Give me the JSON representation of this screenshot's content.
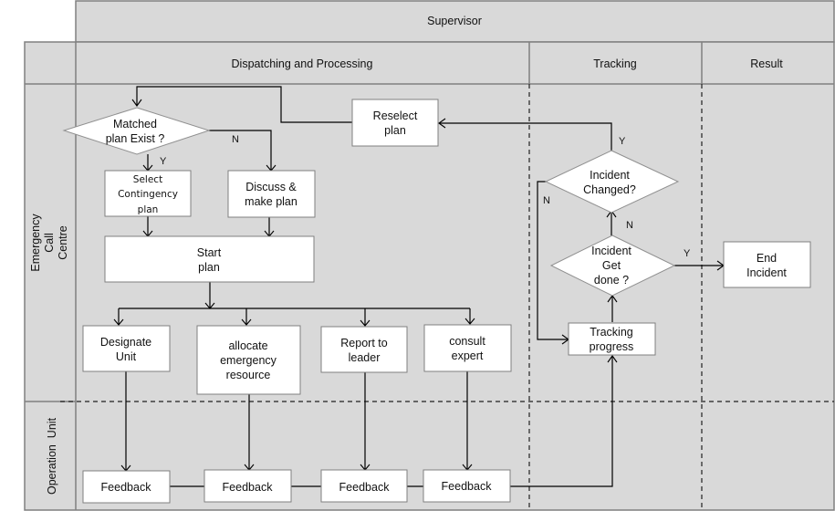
{
  "lanes": {
    "supervisor": "Supervisor",
    "columns": [
      "Dispatching and Processing",
      "Tracking",
      "Result"
    ],
    "rows": [
      "Emergency Call Centre",
      "Operation Unit"
    ],
    "row_lines": {
      "emergency": [
        "Emergency",
        "Call",
        "Centre"
      ],
      "operation": "Operation  Unit"
    }
  },
  "nodes": {
    "matched_plan": [
      "Matched",
      "plan Exist ?"
    ],
    "select_contingency": [
      "Select",
      "Contingency",
      "plan"
    ],
    "discuss_plan": [
      "Discuss &",
      "make plan"
    ],
    "reselect_plan": [
      "Reselect",
      "plan"
    ],
    "start_plan": [
      "Start",
      "plan"
    ],
    "designate_unit": [
      "Designate",
      "Unit"
    ],
    "allocate_resource": [
      "allocate",
      "emergency",
      "resource"
    ],
    "report_leader": [
      "Report to",
      "leader"
    ],
    "consult_expert": [
      "consult",
      "expert"
    ],
    "feedback": [
      "Feedback",
      "Feedback",
      "Feedback",
      "Feedback"
    ],
    "incident_changed": [
      "Incident",
      "Changed?"
    ],
    "incident_done": [
      "Incident",
      "Get",
      "done ?"
    ],
    "tracking_progress": [
      "Tracking",
      "progress"
    ],
    "end_incident": [
      "End",
      "Incident"
    ]
  },
  "edge_labels": {
    "matched_yes": "Y",
    "matched_no": "N",
    "changed_yes": "Y",
    "changed_no": "N",
    "done_no": "N",
    "done_yes": "Y"
  }
}
